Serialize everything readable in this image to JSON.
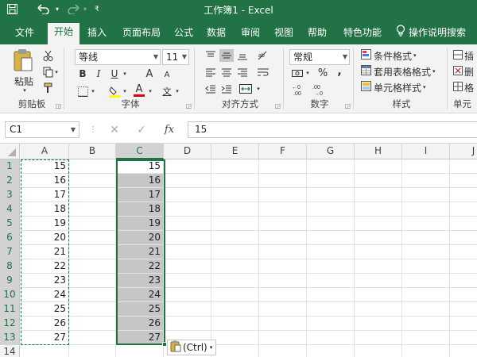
{
  "window": {
    "title": "工作簿1 - Excel"
  },
  "quick_access": {
    "save_icon": "save-icon",
    "undo_icon": "undo-icon",
    "redo_icon": "redo-icon",
    "customize_icon": "customize-qat-icon"
  },
  "tabs": [
    {
      "label": "文件"
    },
    {
      "label": "开始"
    },
    {
      "label": "插入"
    },
    {
      "label": "页面布局"
    },
    {
      "label": "公式"
    },
    {
      "label": "数据"
    },
    {
      "label": "审阅"
    },
    {
      "label": "视图"
    },
    {
      "label": "帮助"
    },
    {
      "label": "特色功能"
    }
  ],
  "tell_me": {
    "label": "操作说明搜索",
    "icon": "lightbulb-icon"
  },
  "ribbon": {
    "clipboard": {
      "label": "剪贴板",
      "paste": "粘贴"
    },
    "font": {
      "label": "字体",
      "family": "等线",
      "size": "11",
      "bold": "B",
      "italic": "I",
      "underline": "U",
      "grow": "A",
      "shrink": "A",
      "font_color": "A",
      "phonetic": "文"
    },
    "alignment": {
      "label": "对齐方式"
    },
    "number": {
      "label": "数字",
      "format": "常规",
      "percent": "%",
      "comma": ","
    },
    "styles": {
      "label": "样式",
      "conditional": "条件格式",
      "table": "套用表格格式",
      "cell_styles": "单元格样式"
    },
    "cells": {
      "label": "单元",
      "insert": "插",
      "delete": "删",
      "format": "格"
    }
  },
  "formula_bar": {
    "name_box": "C1",
    "value": "15",
    "fx": "fx"
  },
  "columns": [
    "A",
    "B",
    "C",
    "D",
    "E",
    "F",
    "G",
    "H",
    "I",
    "J"
  ],
  "rows": [
    "1",
    "2",
    "3",
    "4",
    "5",
    "6",
    "7",
    "8",
    "9",
    "10",
    "11",
    "12",
    "13",
    "14"
  ],
  "col_a": [
    "15",
    "16",
    "17",
    "18",
    "19",
    "20",
    "21",
    "22",
    "23",
    "24",
    "25",
    "26",
    "27"
  ],
  "col_c": [
    "15",
    "16",
    "17",
    "18",
    "19",
    "20",
    "21",
    "22",
    "23",
    "24",
    "25",
    "26",
    "27"
  ],
  "paste_options": {
    "label": "(Ctrl)"
  },
  "colors": {
    "excel_green": "#217346",
    "selection_gray": "#c6c6c6"
  }
}
